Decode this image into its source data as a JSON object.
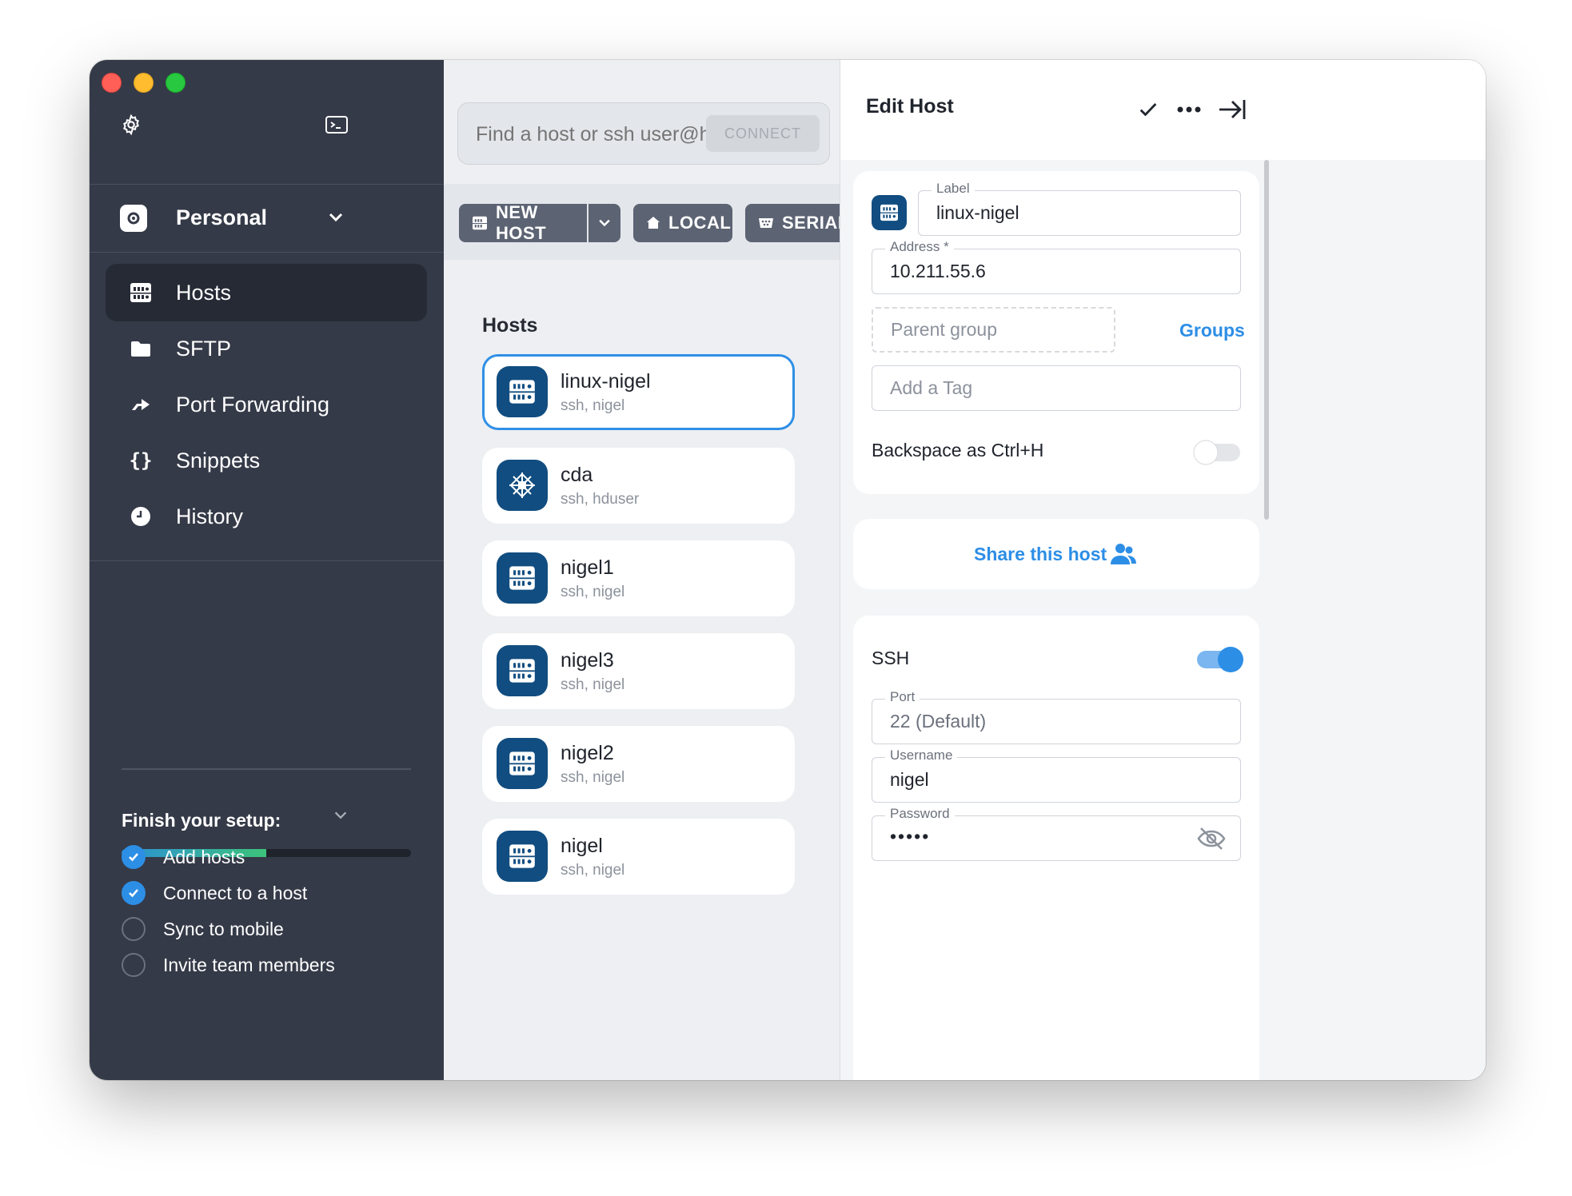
{
  "sidebar": {
    "vault_name": "Personal",
    "nav": [
      {
        "label": "Hosts",
        "icon": "hosts-icon",
        "active": true
      },
      {
        "label": "SFTP",
        "icon": "folder-icon",
        "active": false
      },
      {
        "label": "Port Forwarding",
        "icon": "arrow-forward-icon",
        "active": false
      },
      {
        "label": "Snippets",
        "icon": "braces-icon",
        "active": false
      },
      {
        "label": "History",
        "icon": "clock-icon",
        "active": false
      }
    ],
    "setup": {
      "title": "Finish your setup:",
      "progress": 0.5,
      "items": [
        {
          "label": "Add hosts",
          "done": true
        },
        {
          "label": "Connect to a host",
          "done": true
        },
        {
          "label": "Sync to mobile",
          "done": false
        },
        {
          "label": "Invite team members",
          "done": false
        }
      ]
    }
  },
  "search": {
    "placeholder": "Find a host or ssh user@hostname",
    "connect_label": "CONNECT"
  },
  "toolbar": {
    "new_host": "NEW HOST",
    "local": "LOCAL",
    "serial": "SERIAL"
  },
  "hosts": {
    "title": "Hosts",
    "items": [
      {
        "name": "linux-nigel",
        "sub": "ssh, nigel",
        "icon": "server-icon",
        "selected": true
      },
      {
        "name": "cda",
        "sub": "ssh, hduser",
        "icon": "centos-icon",
        "selected": false
      },
      {
        "name": "nigel1",
        "sub": "ssh, nigel",
        "icon": "server-icon",
        "selected": false
      },
      {
        "name": "nigel3",
        "sub": "ssh, nigel",
        "icon": "server-icon",
        "selected": false
      },
      {
        "name": "nigel2",
        "sub": "ssh, nigel",
        "icon": "server-icon",
        "selected": false
      },
      {
        "name": "nigel",
        "sub": "ssh, nigel",
        "icon": "server-icon",
        "selected": false
      }
    ]
  },
  "edit": {
    "title": "Edit Host",
    "label_caption": "Label",
    "label_value": "linux-nigel",
    "address_caption": "Address *",
    "address_value": "10.211.55.6",
    "parent_group_placeholder": "Parent group",
    "groups_link": "Groups",
    "tag_placeholder": "Add a Tag",
    "backspace_label": "Backspace as Ctrl+H",
    "backspace_on": false,
    "share_label": "Share this host",
    "ssh_label": "SSH",
    "ssh_on": true,
    "port_caption": "Port",
    "port_placeholder": "22 (Default)",
    "username_caption": "Username",
    "username_value": "nigel",
    "password_caption": "Password",
    "password_value": "•••••"
  },
  "colors": {
    "sidebar_bg": "#353a48",
    "accent": "#2d8ee6",
    "host_icon_bg": "#114d80"
  }
}
